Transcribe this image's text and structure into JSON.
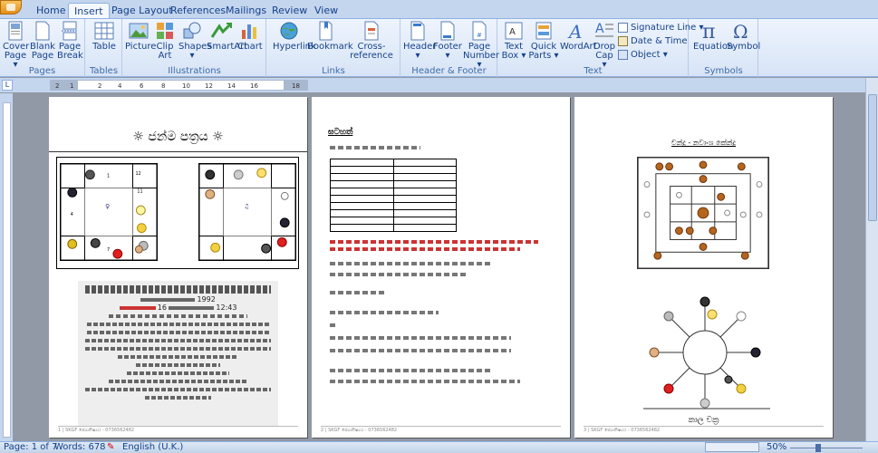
{
  "tabs": [
    "Home",
    "Insert",
    "Page Layout",
    "References",
    "Mailings",
    "Review",
    "View"
  ],
  "active_tab": "Insert",
  "ribbon": {
    "pages": {
      "label": "Pages",
      "buttons": [
        "Cover\nPage",
        "Blank\nPage",
        "Page\nBreak"
      ]
    },
    "tables": {
      "label": "Tables",
      "buttons": [
        "Table"
      ]
    },
    "illustrations": {
      "label": "Illustrations",
      "buttons": [
        "Picture",
        "Clip\nArt",
        "Shapes",
        "SmartArt",
        "Chart"
      ]
    },
    "links": {
      "label": "Links",
      "buttons": [
        "Hyperlink",
        "Bookmark",
        "Cross-reference"
      ]
    },
    "header_footer": {
      "label": "Header & Footer",
      "buttons": [
        "Header",
        "Footer",
        "Page\nNumber"
      ]
    },
    "text": {
      "label": "Text",
      "buttons": [
        "Text\nBox",
        "Quick\nParts",
        "WordArt",
        "Drop\nCap"
      ],
      "small": [
        "Signature Line",
        "Date & Time",
        "Object"
      ]
    },
    "symbols": {
      "label": "Symbols",
      "buttons": [
        "Equation",
        "Symbol"
      ]
    }
  },
  "ruler_numbers": [
    "2",
    "1",
    "2",
    "4",
    "6",
    "8",
    "10",
    "12",
    "14",
    "16",
    "18"
  ],
  "status": {
    "page": "Page: 1 of 7",
    "words": "Words: 678",
    "language": "English (U.K.)",
    "zoom": "50%"
  },
  "colors": {
    "ribbon_bg": "#dbe6f5",
    "accent": "#15428b",
    "doc_bg": "#9199a6"
  },
  "pages": [
    {
      "title": "ජන්ම පත්‍රය",
      "time": "12:43",
      "year": "1992",
      "day": "16",
      "footer_num": "1",
      "footer_text": "SKGF ජ්‍යොතිෂ්‍යය - 0736562482"
    },
    {
      "title": "ඝටහත්",
      "footer_num": "2",
      "footer_text": "SKGF ජ්‍යොතිෂ්‍යය - 0736562482"
    },
    {
      "title": "චන්ද්‍ර - නවාංශ කේන්ද්‍ර",
      "footer_label": "කාල චක්‍ර",
      "footer_num": "3",
      "footer_text": "SKGF ජ්‍යොතිෂ්‍යය - 0736562482"
    }
  ]
}
